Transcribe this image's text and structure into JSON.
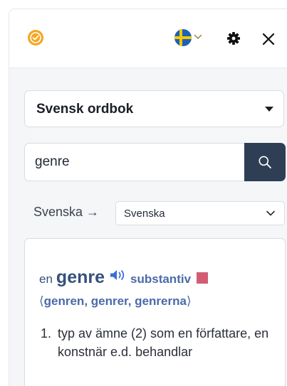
{
  "header": {
    "logo_icon": "check-badge-icon",
    "language_flag": "swedish-flag",
    "settings_icon": "gear-icon",
    "close_icon": "close-icon"
  },
  "dictionary": {
    "selected": "Svensk ordbok"
  },
  "search": {
    "value": "genre",
    "button_icon": "search-icon"
  },
  "languages": {
    "from": "Svenska →",
    "to": "Svenska"
  },
  "entry": {
    "article": "en",
    "headword": "genre",
    "part_of_speech": "substantiv",
    "inflections_open": "⟨",
    "inflections": "genren, genrer, genrerna",
    "inflections_close": "⟩",
    "definitions": [
      {
        "number": "1.",
        "text": "typ av ämne (2) som en författare, en konstnär e.d. behandlar"
      }
    ]
  },
  "colors": {
    "accent_dark": "#2e3e54",
    "link_blue": "#4a6aa8",
    "logo_orange": "#f5a623",
    "tag_pink": "#d15d73"
  }
}
